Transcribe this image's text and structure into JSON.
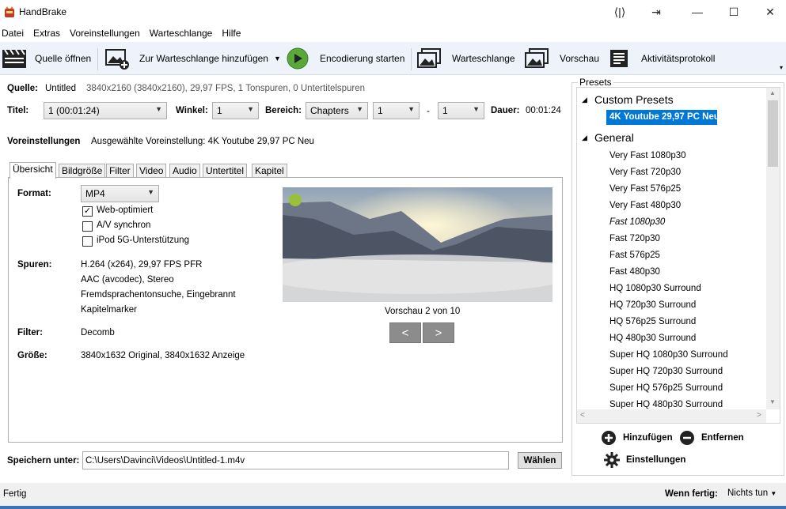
{
  "window": {
    "title": "HandBrake"
  },
  "menu": [
    "Datei",
    "Extras",
    "Voreinstellungen",
    "Warteschlange",
    "Hilfe"
  ],
  "toolbar": {
    "open_source": "Quelle öffnen",
    "add_queue": "Zur Warteschlange hinzufügen",
    "start": "Encodierung starten",
    "queue": "Warteschlange",
    "preview": "Vorschau",
    "activity": "Aktivitätsprotokoll"
  },
  "source": {
    "label": "Quelle:",
    "name": "Untitled",
    "info": "3840x2160 (3840x2160), 29,97 FPS, 1 Tonspuren, 0 Untertitelspuren"
  },
  "title_row": {
    "title_label": "Titel:",
    "title_value": "1 (00:01:24)",
    "angle_label": "Winkel:",
    "angle_value": "1",
    "range_label": "Bereich:",
    "range_type": "Chapters",
    "range_from": "1",
    "range_dash": "-",
    "range_to": "1",
    "duration_label": "Dauer:",
    "duration_value": "00:01:24"
  },
  "preset_row": {
    "label": "Voreinstellungen",
    "selected": "Ausgewählte Voreinstellung: 4K Youtube 29,97 PC Neu"
  },
  "tabs": [
    "Übersicht",
    "Bildgröße",
    "Filter",
    "Video",
    "Audio",
    "Untertitel",
    "Kapitel"
  ],
  "summary": {
    "format_label": "Format:",
    "format_value": "MP4",
    "web_optimized": "Web-optimiert",
    "web_optimized_checked": true,
    "av_sync": "A/V synchron",
    "av_sync_checked": false,
    "ipod": "iPod 5G-Unterstützung",
    "ipod_checked": false,
    "tracks_label": "Spuren:",
    "tracks": [
      "H.264 (x264), 29,97 FPS PFR",
      "AAC (avcodec), Stereo",
      "Fremdsprachentonsuche, Eingebrannt",
      "Kapitelmarker"
    ],
    "filter_label": "Filter:",
    "filter_value": "Decomb",
    "size_label": "Größe:",
    "size_value": "3840x1632 Original, 3840x1632 Anzeige",
    "preview_caption": "Vorschau 2 von 10",
    "prev_btn": "<",
    "next_btn": ">"
  },
  "save": {
    "label": "Speichern unter:",
    "path": "C:\\Users\\Davinci\\Videos\\Untitled-1.m4v",
    "choose_btn": "Wählen"
  },
  "presets": {
    "caption": "Presets",
    "groups": [
      {
        "name": "Custom Presets",
        "items": [
          "4K Youtube 29,97 PC Neu"
        ]
      },
      {
        "name": "General",
        "items": [
          "Very Fast 1080p30",
          "Very Fast 720p30",
          "Very Fast 576p25",
          "Very Fast 480p30",
          "Fast 1080p30",
          "Fast 720p30",
          "Fast 576p25",
          "Fast 480p30",
          "HQ 1080p30 Surround",
          "HQ 720p30 Surround",
          "HQ 576p25 Surround",
          "HQ 480p30 Surround",
          "Super HQ 1080p30 Surround",
          "Super HQ 720p30 Surround",
          "Super HQ 576p25 Surround",
          "Super HQ 480p30 Surround"
        ]
      }
    ],
    "selected": "4K Youtube 29,97 PC Neu",
    "add_btn": "Hinzufügen",
    "remove_btn": "Entfernen",
    "settings_btn": "Einstellungen"
  },
  "status": {
    "text": "Fertig",
    "when_done_label": "Wenn fertig:",
    "when_done_value": "Nichts tun"
  },
  "colors": {
    "selection": "#0078d7",
    "toolbar_bg": "#eef3fb",
    "start_green": "#5aa83a"
  }
}
